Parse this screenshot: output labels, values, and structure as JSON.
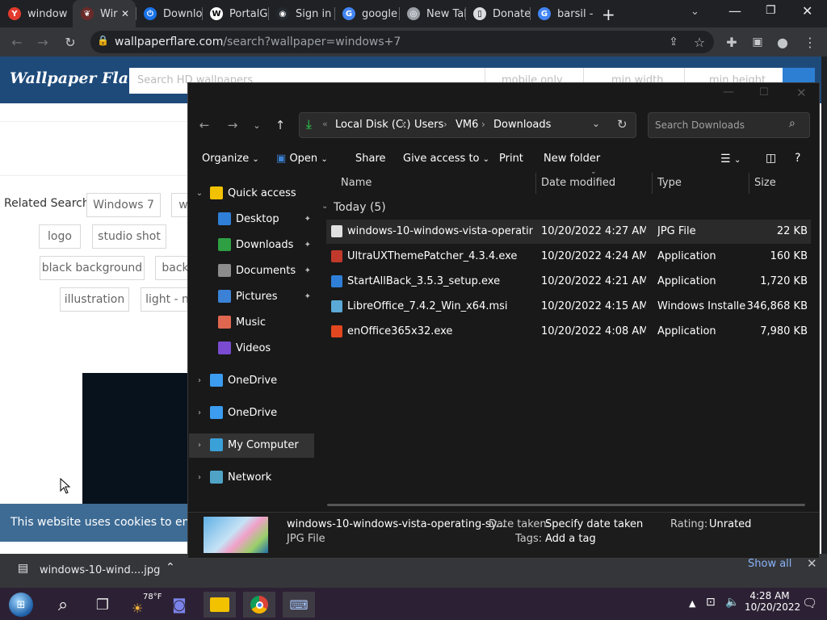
{
  "browser": {
    "tabs": [
      {
        "label": "window",
        "fav_color": "#e33b2e",
        "fav_text": "Y"
      },
      {
        "label": "Wir",
        "fav_color": "#6b2a2a",
        "fav_text": "❦"
      },
      {
        "label": "Downlo",
        "fav_color": "#1a73e8",
        "fav_text": "⏻"
      },
      {
        "label": "PortalG",
        "fav_color": "#ffffff",
        "fav_text": "W"
      },
      {
        "label": "Sign in",
        "fav_color": "#24292f",
        "fav_text": "◉"
      },
      {
        "label": "google",
        "fav_color": "#4285f4",
        "fav_text": "G"
      },
      {
        "label": "New Tal",
        "fav_color": "#9aa0a6",
        "fav_text": "◎"
      },
      {
        "label": "Donate",
        "fav_color": "#dadce0",
        "fav_text": "▯"
      },
      {
        "label": "barsil -",
        "fav_color": "#4285f4",
        "fav_text": "G"
      }
    ],
    "url_host": "wallpaperflare.com",
    "url_path": "/search?wallpaper=windows+7"
  },
  "site": {
    "logo": "Wallpaper Flare",
    "search_placeholder": "Search HD wallpapers",
    "mobile_only": "mobile only",
    "min_width": "min width",
    "min_height": "min height",
    "related_label": "Related Search:",
    "chips": [
      "Windows 7",
      "w",
      "logo",
      "studio shot",
      "black background",
      "back",
      "illustration",
      "light - n"
    ],
    "cookie_text": "This website uses cookies to ensure y"
  },
  "download_bar": {
    "file": "windows-10-wind....jpg",
    "show_all": "Show all"
  },
  "explorer": {
    "breadcrumb": [
      "Local Disk (C:)",
      "Users",
      "VM6",
      "Downloads"
    ],
    "search_placeholder": "Search Downloads",
    "commands": {
      "organize": "Organize",
      "open": "Open",
      "share": "Share",
      "give_access": "Give access to",
      "print": "Print",
      "new_folder": "New folder"
    },
    "nav": [
      {
        "label": "Quick access",
        "color": "#f2c200",
        "chev": "⌄",
        "pin": ""
      },
      {
        "label": "Desktop",
        "color": "#2f7fd8",
        "chev": "",
        "pin": "📌"
      },
      {
        "label": "Downloads",
        "color": "#2ea043",
        "chev": "",
        "pin": "📌"
      },
      {
        "label": "Documents",
        "color": "#8c8c8c",
        "chev": "",
        "pin": "📌"
      },
      {
        "label": "Pictures",
        "color": "#3b82d6",
        "chev": "",
        "pin": "📌"
      },
      {
        "label": "Music",
        "color": "#e0674f",
        "chev": "",
        "pin": ""
      },
      {
        "label": "Videos",
        "color": "#7a4bd1",
        "chev": "",
        "pin": ""
      },
      {
        "label": "OneDrive",
        "color": "#3b9cf0",
        "chev": "›",
        "pin": ""
      },
      {
        "label": "OneDrive",
        "color": "#3b9cf0",
        "chev": "›",
        "pin": ""
      },
      {
        "label": "My Computer",
        "color": "#3aa0d8",
        "chev": "›",
        "pin": ""
      },
      {
        "label": "Network",
        "color": "#4fa3c7",
        "chev": "›",
        "pin": ""
      }
    ],
    "columns": {
      "name": "Name",
      "date": "Date modified",
      "type": "Type",
      "size": "Size"
    },
    "group": "Today (5)",
    "files": [
      {
        "name": "windows-10-windows-vista-operating-sy...",
        "date": "10/20/2022 4:27 AM",
        "type": "JPG File",
        "size": "22 KB",
        "color": "#e0e0e0"
      },
      {
        "name": "UltraUXThemePatcher_4.3.4.exe",
        "date": "10/20/2022 4:24 AM",
        "type": "Application",
        "size": "160 KB",
        "color": "#c0392b"
      },
      {
        "name": "StartAllBack_3.5.3_setup.exe",
        "date": "10/20/2022 4:21 AM",
        "type": "Application",
        "size": "1,720 KB",
        "color": "#2f7fd8"
      },
      {
        "name": "LibreOffice_7.4.2_Win_x64.msi",
        "date": "10/20/2022 4:15 AM",
        "type": "Windows Installer ...",
        "size": "346,868 KB",
        "color": "#5aa9d6"
      },
      {
        "name": "enOffice365x32.exe",
        "date": "10/20/2022 4:08 AM",
        "type": "Application",
        "size": "7,980 KB",
        "color": "#e3471f"
      }
    ],
    "details": {
      "name": "windows-10-windows-vista-operating-sy...",
      "kind": "JPG File",
      "date_taken_label": "Date taken:",
      "date_taken_value": "Specify date taken",
      "tags_label": "Tags:",
      "tags_value": "Add a tag",
      "rating_label": "Rating:",
      "rating_value": "Unrated"
    }
  },
  "taskbar": {
    "weather": "78°F",
    "time": "4:28 AM",
    "date": "10/20/2022"
  }
}
